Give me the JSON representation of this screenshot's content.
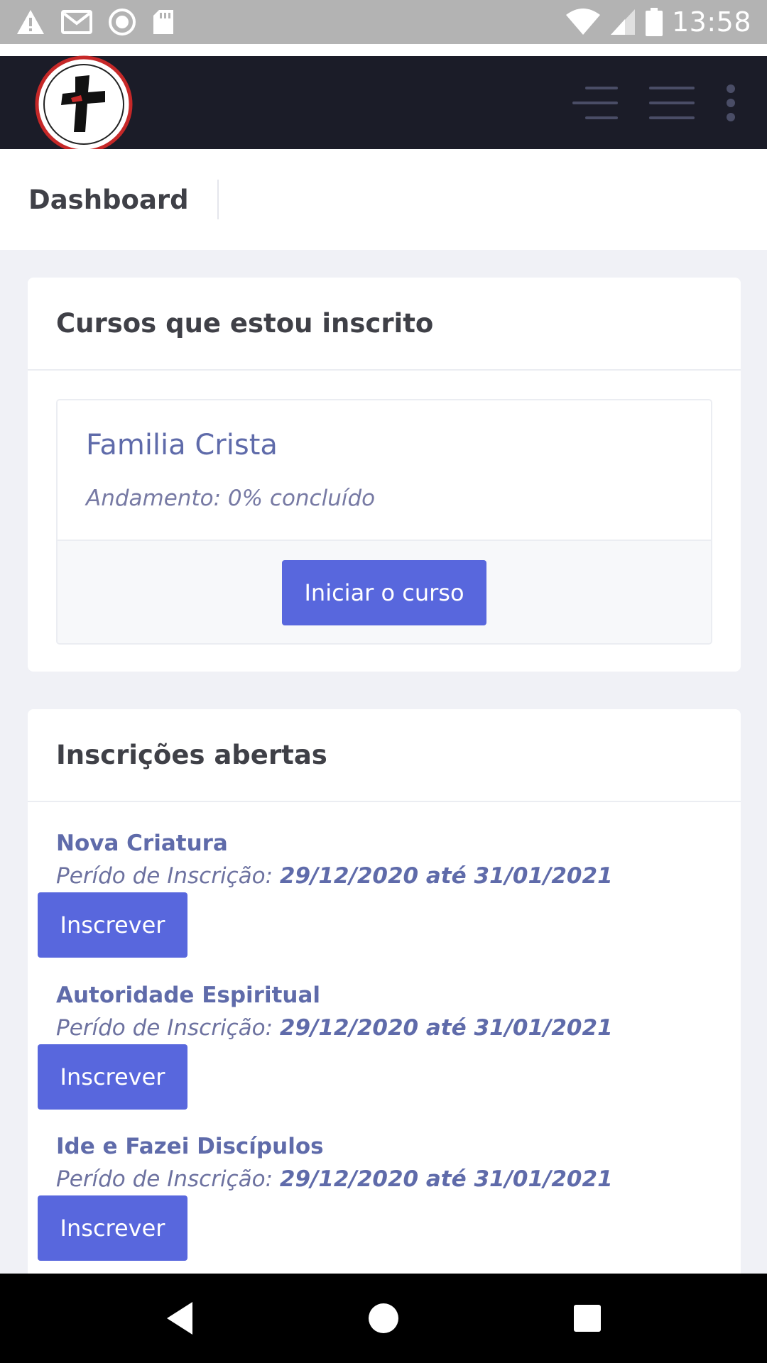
{
  "status_bar": {
    "time": "13:58",
    "icons": [
      "warning-icon",
      "gmail-icon",
      "record-icon",
      "sd-card-icon",
      "wifi-icon",
      "signal-icon",
      "battery-icon"
    ]
  },
  "header": {
    "logo_icon": "church-logo-cross-icon",
    "actions": [
      "sidebar-toggle-icon",
      "menu-icon",
      "more-vert-icon"
    ]
  },
  "page": {
    "title": "Dashboard"
  },
  "enrolled": {
    "title": "Cursos que estou inscrito",
    "course": {
      "name": "Familia Crista",
      "progress": "Andamento: 0% concluído",
      "button": "Iniciar o curso"
    }
  },
  "open": {
    "title": "Inscrições abertas",
    "items": [
      {
        "name": "Nova Criatura",
        "period_label": "Perído de Inscrição:",
        "period_dates": "29/12/2020 até 31/01/2021",
        "button": "Inscrever"
      },
      {
        "name": "Autoridade Espiritual",
        "period_label": "Perído de Inscrição:",
        "period_dates": "29/12/2020 até 31/01/2021",
        "button": "Inscrever"
      },
      {
        "name": "Ide e Fazei Discípulos",
        "period_label": "Perído de Inscrição:",
        "period_dates": "29/12/2020 até 31/01/2021",
        "button": "Inscrever"
      }
    ]
  },
  "colors": {
    "primary": "#5867dd",
    "header_bg": "#1b1c28",
    "page_bg": "#f0f1f6",
    "link_text": "#5f6baa"
  },
  "nav_bar": {
    "buttons": [
      "back-icon",
      "home-icon",
      "recents-icon"
    ]
  }
}
